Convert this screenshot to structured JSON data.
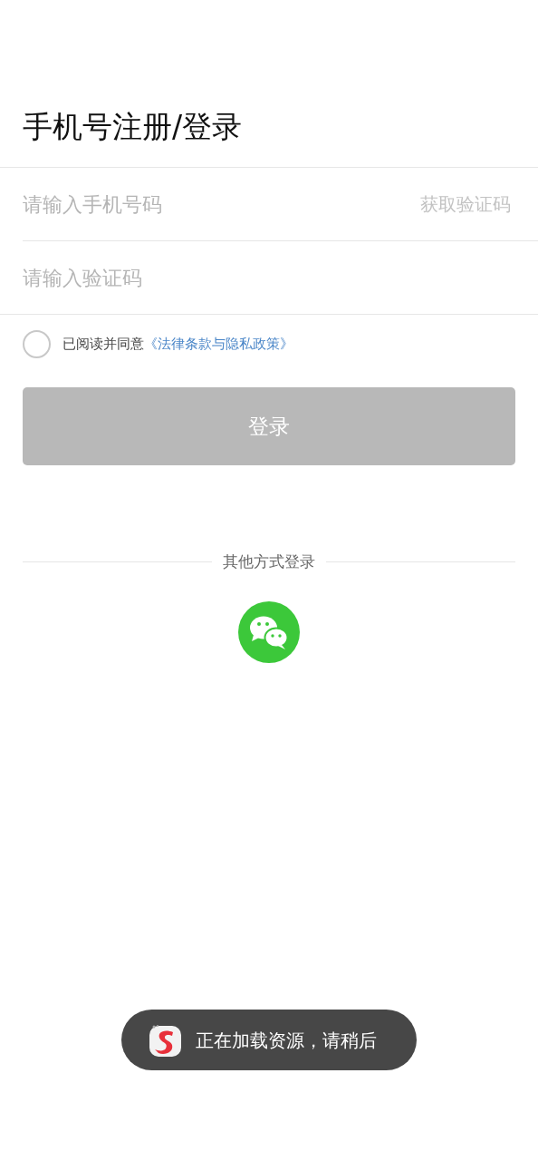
{
  "title": "手机号注册/登录",
  "phone_field": {
    "placeholder": "请输入手机号码"
  },
  "get_code_button": {
    "label": "获取验证码",
    "disabled": true
  },
  "code_field": {
    "placeholder": "请输入验证码"
  },
  "agreement": {
    "checked": false,
    "text": "已阅读并同意",
    "link": "《法律条款与隐私政策》"
  },
  "login_button": {
    "label": "登录",
    "disabled": true
  },
  "other_login": {
    "label": "其他方式登录"
  },
  "toast": {
    "text": "正在加载资源，请稍后"
  }
}
